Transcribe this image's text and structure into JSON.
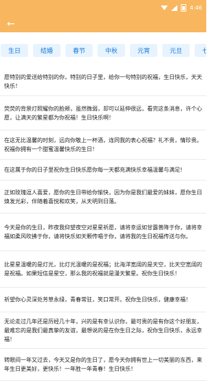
{
  "status_bar": {
    "time": "4:46"
  },
  "toolbar": {
    "back_icon": "arrow-left-icon"
  },
  "tabs": [
    {
      "label": "生日"
    },
    {
      "label": "结婚"
    },
    {
      "label": "春节"
    },
    {
      "label": "中秋"
    },
    {
      "label": "元宵"
    },
    {
      "label": "元旦"
    },
    {
      "label": "七夕"
    }
  ],
  "wishes": [
    {
      "text": "愿特别的爱送给特别的你，特别的日子里，给你一句特别的祝福，生日快乐，天天快乐！"
    },
    {
      "text": "荧荧的背景灯照耀你的脸颊，虽然微弱，却可以延伸很远，看完这条消息，许个心愿，让满天的繁星都为你祝福！生日快乐啊！"
    },
    {
      "text": "在这无比温馨的时刻，远向你敬上一杯酒，连同我的表心祝福？礼不贵，情珍贵。祝福你拥有一个甜蜜温馨快乐的生日！"
    },
    {
      "text": "在这属于你的日子里祝你生日快乐愿你每一天都充满快乐幸福温馨与满足!"
    },
    {
      "text": "正如玫瑰逗人喜爱，愿你的生日带给你愉快，因为你是我们最爱的妹妹，愿你生日焕发光彩，伴随着喜悦和欢笑，从天明到日落。"
    },
    {
      "text": "今天是你的生日，昨夜我仰望夜空对星星祈愿，请将幸运如甘露普降于你，请将幸福如柔风吹拂于你，请将快乐如天颗传唱于你，请将我的生日祝福传送与你。"
    },
    {
      "text": "比星星温暖的是灯光，比灯光温暖的是祝福；比海洋宽阔的是天空，比天空宽阔的是祝福。如果短信是星空，那么我的祝福就是漫天繁星。祝你生日快乐！"
    },
    {
      "text": "祈望你心灵深处芳草永绿，青春常驻，笑口常开。祝你生日快乐，健康幸福！"
    },
    {
      "text": "无论走过几年还是历经几十年，兴的是有幸认识你，最可贵的是有你这个好朋友，最难忘的是我们最真挚的友谊，最想说的是在你生日之际，祝你生日快乐，永远幸福！"
    },
    {
      "text": "转眼间一年又过去，今天又是你的生日了，愿今天你拥有世上一切美丽的东西，来年生日更美好，更快乐！一年胜一年青春！生日快乐！"
    }
  ]
}
